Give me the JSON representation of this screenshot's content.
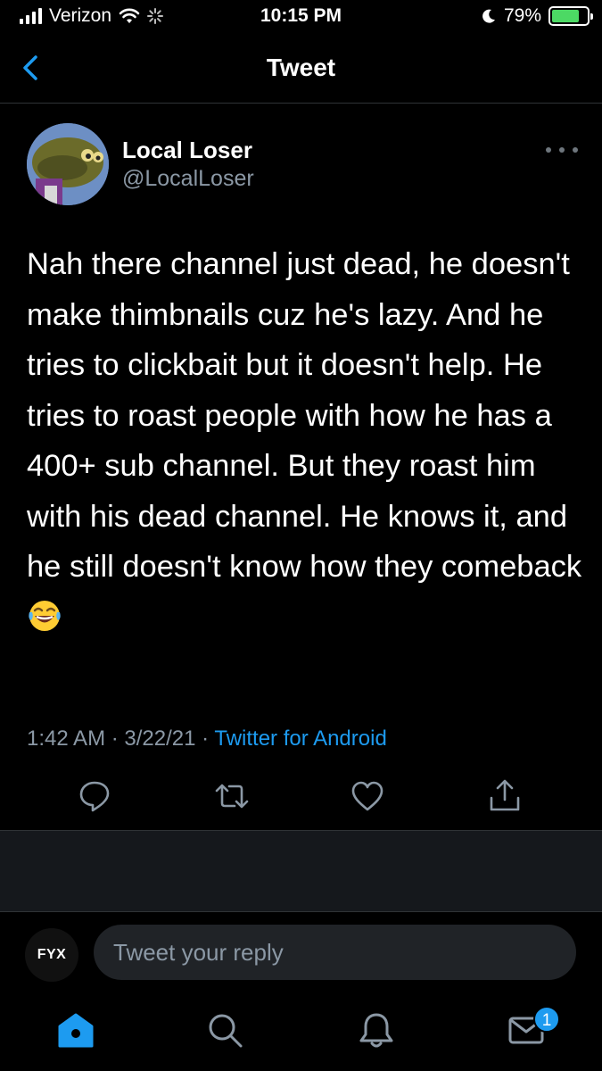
{
  "status_bar": {
    "carrier": "Verizon",
    "time": "10:15 PM",
    "battery": "79%",
    "battery_level": 0.79,
    "icons": [
      "signal-icon",
      "wifi-icon",
      "activity-icon",
      "moon-icon",
      "battery-charging-icon"
    ]
  },
  "header": {
    "title": "Tweet",
    "back_icon": "chevron-left-icon"
  },
  "tweet": {
    "display_name": "Local Loser",
    "handle": "@LocalLoser",
    "text": "Nah there channel just dead, he doesn't make thimbnails cuz he's lazy. And he tries to clickbait but it doesn't help. He tries to roast people with how he has a 400+ sub channel. But they roast him with his dead channel. He knows it, and he still doesn't know how they comeback",
    "emoji": "face-with-tears-of-joy",
    "time": "1:42 AM",
    "date": "3/22/21",
    "separator": " · ",
    "source": "Twitter for Android"
  },
  "actions": {
    "icons": [
      "reply-icon",
      "retweet-icon",
      "like-icon",
      "share-icon"
    ]
  },
  "reply_bar": {
    "avatar_text": "FYX",
    "placeholder": "Tweet your reply"
  },
  "bottom_nav": {
    "icons": [
      "home-icon",
      "search-icon",
      "notifications-icon",
      "messages-icon"
    ],
    "messages_badge": "1"
  },
  "colors": {
    "background": "#000000",
    "accent": "#1d9bf0",
    "secondary_text": "#8b98a5"
  }
}
